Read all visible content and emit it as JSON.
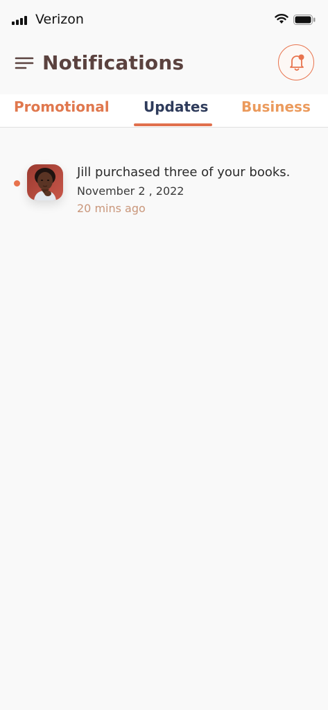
{
  "status_bar": {
    "carrier": "Verizon",
    "signal_icon": "cellular-signal-icon",
    "wifi_icon": "wifi-icon",
    "battery_icon": "battery-icon"
  },
  "header": {
    "title": "Notifications",
    "menu_icon": "hamburger-menu-icon",
    "bell_icon": "bell-with-badge-icon"
  },
  "tabs": [
    {
      "label": "Promotional",
      "active": false
    },
    {
      "label": "Updates",
      "active": true
    },
    {
      "label": "Business",
      "active": false
    }
  ],
  "notifications": [
    {
      "message": "Jill purchased three of your books.",
      "date": "November 2 , 2022",
      "time_ago": "20 mins ago",
      "unread": true
    }
  ],
  "colors": {
    "accent": "#e8734d",
    "title": "#5b423f",
    "active_tab": "#2e3b5b",
    "background": "#f9f9f9"
  }
}
